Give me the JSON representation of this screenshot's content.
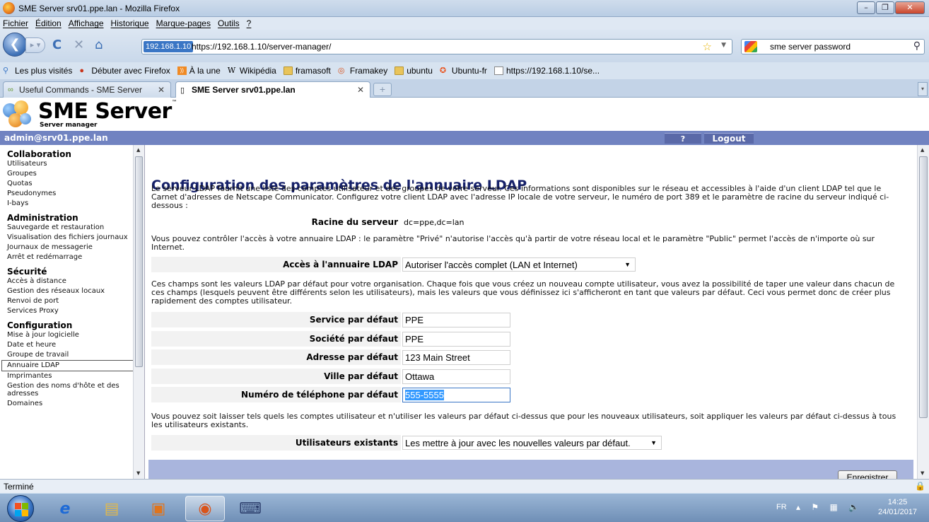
{
  "window": {
    "title": "SME Server srv01.ppe.lan - Mozilla Firefox",
    "menu": [
      "Fichier",
      "Édition",
      "Affichage",
      "Historique",
      "Marque-pages",
      "Outils",
      "?"
    ]
  },
  "navbar": {
    "url_badge": "192.168.1.10",
    "url": "https://192.168.1.10/server-manager/",
    "search_value": "sme server password"
  },
  "bookmarks": [
    {
      "label": "Les plus visités",
      "icon": "search-icon"
    },
    {
      "label": "Débuter avec Firefox",
      "icon": "firefox-icon"
    },
    {
      "label": "À la une",
      "icon": "rss-icon"
    },
    {
      "label": "Wikipédia",
      "icon": "wikipedia-icon"
    },
    {
      "label": "framasoft",
      "icon": "folder-icon"
    },
    {
      "label": "Framakey",
      "icon": "framakey-icon"
    },
    {
      "label": "ubuntu",
      "icon": "folder-icon"
    },
    {
      "label": "Ubuntu-fr",
      "icon": "ubuntu-icon"
    },
    {
      "label": "https://192.168.1.10/se...",
      "icon": "page-icon"
    }
  ],
  "tabs": [
    {
      "label": "Useful Commands - SME Server",
      "active": false
    },
    {
      "label": "SME Server srv01.ppe.lan",
      "active": true
    }
  ],
  "sme": {
    "brand": "SME Server",
    "tm": "™",
    "subtitle": "Server manager",
    "user": "admin@srv01.ppe.lan",
    "help": "?",
    "logout": "Logout"
  },
  "sidenav": {
    "collaboration": {
      "title": "Collaboration",
      "items": [
        "Utilisateurs",
        "Groupes",
        "Quotas",
        "Pseudonymes",
        "I-bays"
      ]
    },
    "administration": {
      "title": "Administration",
      "items": [
        "Sauvegarde et restauration",
        "Visualisation des fichiers journaux",
        "Journaux de messagerie",
        "Arrêt et redémarrage"
      ]
    },
    "securite": {
      "title": "Sécurité",
      "items": [
        "Accès à distance",
        "Gestion des réseaux locaux",
        "Renvoi de port",
        "Services Proxy"
      ]
    },
    "configuration": {
      "title": "Configuration",
      "items": [
        "Mise à jour logicielle",
        "Date et heure",
        "Groupe de travail",
        "Annuaire LDAP",
        "Imprimantes",
        "Gestion des noms d'hôte et des adresses",
        "Domaines"
      ]
    }
  },
  "main": {
    "title": "Configuration des paramètres de l'annuaire LDAP",
    "intro": "Le serveur LDAP fournit une liste des comptes utilisateur et des groupes de votre serveur. Ces informations sont disponibles sur le réseau et accessibles à l'aide d'un client LDAP tel que le Carnet d'adresses de Netscape Communicator. Configurez votre client LDAP avec l'adresse IP locale de votre serveur, le numéro de port 389 et le paramètre de racine du serveur indiqué ci-dessous :",
    "root_label": "Racine du serveur",
    "root_value": "dc=ppe,dc=lan",
    "access_text": "Vous pouvez contrôler l'accès à votre annuaire LDAP : le paramètre \"Privé\" n'autorise l'accès qu'à partir de votre réseau local et le paramètre \"Public\" permet l'accès de n'importe où sur Internet.",
    "access_label": "Accès à l'annuaire LDAP",
    "access_value": "Autoriser l'accès complet (LAN et Internet)",
    "defaults_text": "Ces champs sont les valeurs LDAP par défaut pour votre organisation. Chaque fois que vous créez un nouveau compte utilisateur, vous avez la possibilité de taper une valeur dans chacun de ces champs (lesquels peuvent être différents selon les utilisateurs), mais les valeurs que vous définissez ici s'afficheront en tant que valeurs par défaut. Ceci vous permet donc de créer plus rapidement des comptes utilisateur.",
    "fields": [
      {
        "label": "Service par défaut",
        "value": "PPE"
      },
      {
        "label": "Société par défaut",
        "value": "PPE"
      },
      {
        "label": "Adresse par défaut",
        "value": "123 Main Street"
      },
      {
        "label": "Ville par défaut",
        "value": "Ottawa"
      },
      {
        "label": "Numéro de téléphone par défaut",
        "value": "555-5555"
      }
    ],
    "existing_text": "Vous pouvez soit laisser tels quels les comptes utilisateur et n'utiliser les valeurs par défaut ci-dessus que pour les nouveaux utilisateurs, soit appliquer les valeurs par défaut ci-dessus à tous les utilisateurs existants.",
    "existing_label": "Utilisateurs existants",
    "existing_value": "Les mettre à jour avec les nouvelles valeurs par défaut.",
    "save_label": "Enregistrer"
  },
  "status": "Terminé",
  "taskbar": {
    "lang": "FR",
    "time": "14:25",
    "date": "24/01/2017"
  }
}
